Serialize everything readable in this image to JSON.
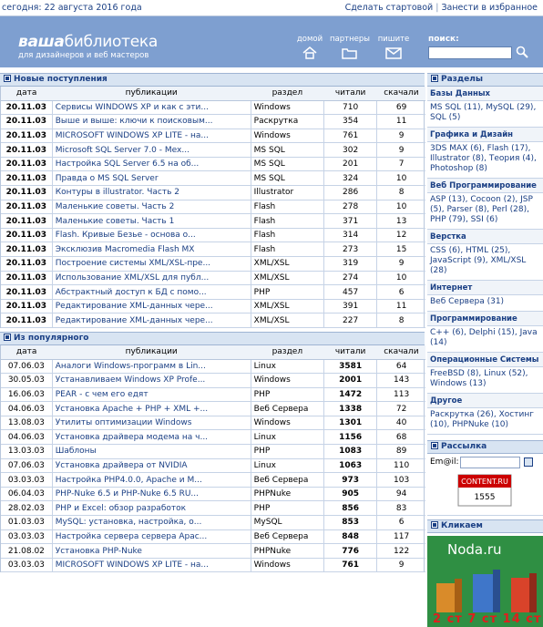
{
  "topbar": {
    "date": "сегодня: 22 августа 2016 года",
    "link_start": "Сделать стартовой",
    "link_fav": "Занести в избранное",
    "sep": "|"
  },
  "header": {
    "logo_bold": "ваша",
    "logo_rest": "библиотека",
    "tagline": "для дизайнеров и веб мастеров",
    "nav": [
      {
        "label": "домой",
        "icon": "home-icon"
      },
      {
        "label": "партнеры",
        "icon": "folder-icon"
      },
      {
        "label": "пишите",
        "icon": "mail-icon"
      }
    ],
    "search_label": "поиск:"
  },
  "new_section": {
    "title": "Новые поступления",
    "columns": [
      "дата",
      "публикации",
      "раздел",
      "читали",
      "скачали"
    ],
    "rows": [
      [
        "20.11.03",
        "Сервисы WINDOWS XP и как с эти...",
        "Windows",
        "710",
        "69"
      ],
      [
        "20.11.03",
        "Выше и выше: ключи к поисковым...",
        "Раскрутка",
        "354",
        "11"
      ],
      [
        "20.11.03",
        "MICROSOFT WINDOWS XP LITE - на...",
        "Windows",
        "761",
        "9"
      ],
      [
        "20.11.03",
        "Microsoft SQL Server 7.0 - Mex...",
        "MS SQL",
        "302",
        "9"
      ],
      [
        "20.11.03",
        "Настройка SQL Server 6.5 на об...",
        "MS SQL",
        "201",
        "7"
      ],
      [
        "20.11.03",
        "Правда о MS SQL Server",
        "MS SQL",
        "324",
        "10"
      ],
      [
        "20.11.03",
        "Контуры в illustrator. Часть 2",
        "Illustrator",
        "286",
        "8"
      ],
      [
        "20.11.03",
        "Маленькие советы. Часть 2",
        "Flash",
        "278",
        "10"
      ],
      [
        "20.11.03",
        "Маленькие советы. Часть 1",
        "Flash",
        "371",
        "13"
      ],
      [
        "20.11.03",
        "Flash. Кривые Безье - основа о...",
        "Flash",
        "314",
        "12"
      ],
      [
        "20.11.03",
        "Эксклюзив Macromedia Flash MX",
        "Flash",
        "273",
        "15"
      ],
      [
        "20.11.03",
        "Построение системы XML/XSL-пре...",
        "XML/XSL",
        "319",
        "9"
      ],
      [
        "20.11.03",
        "Использование XML/XSL для публ...",
        "XML/XSL",
        "274",
        "10"
      ],
      [
        "20.11.03",
        "Абстрактный доступ к БД с помо...",
        "PHP",
        "457",
        "6"
      ],
      [
        "20.11.03",
        "Редактирование XML-данных чере...",
        "XML/XSL",
        "391",
        "11"
      ],
      [
        "20.11.03",
        "Редактирование XML-данных чере...",
        "XML/XSL",
        "227",
        "8"
      ]
    ]
  },
  "popular_section": {
    "title": "Из популярного",
    "columns": [
      "дата",
      "публикации",
      "раздел",
      "читали",
      "скачали"
    ],
    "rows": [
      [
        "07.06.03",
        "Аналоги Windows-программ в Lin...",
        "Linux",
        "3581",
        "64"
      ],
      [
        "30.05.03",
        "Устанавливаем Windows XP Profe...",
        "Windows",
        "2001",
        "143"
      ],
      [
        "16.06.03",
        "PEAR - с чем его едят",
        "PHP",
        "1472",
        "113"
      ],
      [
        "04.06.03",
        "Установка Apache + PHP + XML +...",
        "Веб Сервера",
        "1338",
        "72"
      ],
      [
        "13.08.03",
        "Утилиты оптимизации Windows",
        "Windows",
        "1301",
        "40"
      ],
      [
        "04.06.03",
        "Установка драйвера модема на ч...",
        "Linux",
        "1156",
        "68"
      ],
      [
        "13.03.03",
        "Шаблоны",
        "PHP",
        "1083",
        "89"
      ],
      [
        "07.06.03",
        "Установка драйвера от NVIDIA",
        "Linux",
        "1063",
        "110"
      ],
      [
        "03.03.03",
        "Настройка PHP4.0.0, Apache и M...",
        "Веб Сервера",
        "973",
        "103"
      ],
      [
        "06.04.03",
        "PHP-Nuke 6.5 и PHP-Nuke 6.5 RU...",
        "PHPNuke",
        "905",
        "94"
      ],
      [
        "28.02.03",
        "PHP и Excel: обзор разработок",
        "PHP",
        "856",
        "83"
      ],
      [
        "01.03.03",
        "MySQL: установка, настройка, о...",
        "MySQL",
        "853",
        "6"
      ],
      [
        "03.03.03",
        "Настройка сервера сервера Apac...",
        "Веб Сервера",
        "848",
        "117"
      ],
      [
        "21.08.02",
        "Установка PHP-Nuke",
        "PHPNuke",
        "776",
        "122"
      ],
      [
        "03.03.03",
        "MICROSOFT WINDOWS XP LITE - на...",
        "Windows",
        "761",
        "9"
      ]
    ]
  },
  "sidebar": {
    "sections_title": "Разделы",
    "categories": [
      {
        "name": "Базы Данных",
        "items": "MS SQL (11), MySQL (29), SQL (5)"
      },
      {
        "name": "Графика и Дизайн",
        "items": "3DS MAX (6), Flash (17), Illustrator (8), Теория (4), Photoshop (8)"
      },
      {
        "name": "Веб Программирование",
        "items": "ASP (13), Cocoon (2), JSP (5), Parser (8), Perl (28), PHP (79), SSI (6)"
      },
      {
        "name": "Верстка",
        "items": "CSS (6), HTML (25), JavaScript (9), XML/XSL (28)"
      },
      {
        "name": "Интернет",
        "items": "Веб Сервера (31)"
      },
      {
        "name": "Программирование",
        "items": "C++ (6), Delphi (15), Java (14)"
      },
      {
        "name": "Операционные Системы",
        "items": "FreeBSD (8), Linux (52), Windows (13)"
      },
      {
        "name": "Другое",
        "items": "Раскрутка (26), Хостинг (10), PHPNuke (10)"
      }
    ],
    "mail_title": "Рассылка",
    "mail_label": "Em@il:",
    "counter_label": "CONTENT.RU",
    "counter_value": "1555",
    "ads_title": "Кликаем",
    "ad_brand": "Noda.ru",
    "ad_numbers": "2 ст  7 ст  14 ст"
  },
  "colors": {
    "header": "#7e9fd0",
    "link": "#1a3f84",
    "ad": "#2f8f43"
  }
}
